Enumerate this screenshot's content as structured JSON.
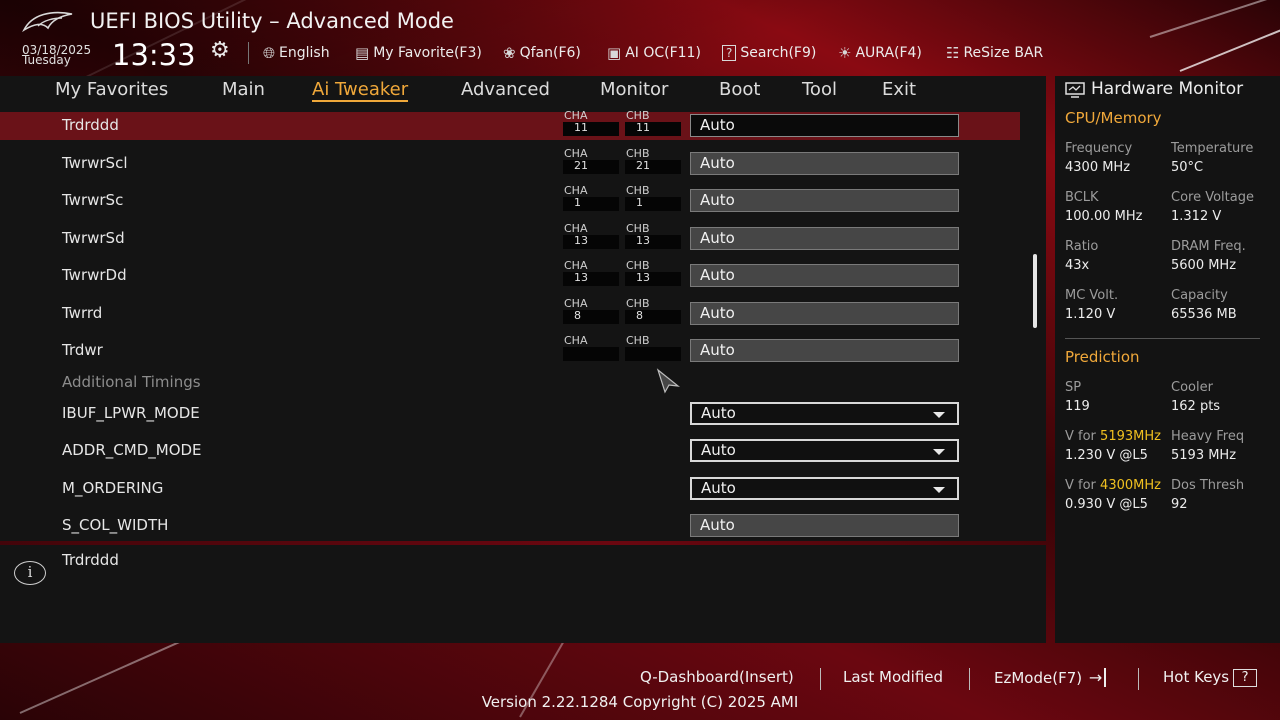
{
  "header": {
    "title": "UEFI BIOS Utility – Advanced Mode",
    "date": "03/18/2025",
    "weekday": "Tuesday",
    "time": "13:33",
    "tools": [
      {
        "label": "English",
        "icon": "globe-icon"
      },
      {
        "label": "My Favorite(F3)",
        "icon": "favorite-list-icon"
      },
      {
        "label": "Qfan(F6)",
        "icon": "fan-icon"
      },
      {
        "label": "AI OC(F11)",
        "icon": "ai-chip-icon"
      },
      {
        "label": "Search(F9)",
        "icon": "search-icon"
      },
      {
        "label": "AURA(F4)",
        "icon": "aura-light-icon"
      },
      {
        "label": "ReSize BAR",
        "icon": "resize-bar-icon"
      }
    ]
  },
  "nav": {
    "tabs": [
      "My Favorites",
      "Main",
      "Ai Tweaker",
      "Advanced",
      "Monitor",
      "Boot",
      "Tool",
      "Exit"
    ],
    "active": "Ai Tweaker"
  },
  "settings": {
    "channel_a_label": "CHA",
    "channel_b_label": "CHB",
    "rows": [
      {
        "label": "Trdrddd",
        "cha": "11",
        "chb": "11",
        "value": "Auto"
      },
      {
        "label": "TwrwrScl",
        "cha": "21",
        "chb": "21",
        "value": "Auto"
      },
      {
        "label": "TwrwrSc",
        "cha": "1",
        "chb": "1",
        "value": "Auto"
      },
      {
        "label": "TwrwrSd",
        "cha": "13",
        "chb": "13",
        "value": "Auto"
      },
      {
        "label": "TwrwrDd",
        "cha": "13",
        "chb": "13",
        "value": "Auto"
      },
      {
        "label": "Twrrd",
        "cha": "8",
        "chb": "8",
        "value": "Auto"
      },
      {
        "label": "Trdwr",
        "cha": "",
        "chb": "",
        "value": "Auto"
      }
    ],
    "section_additional": "Additional Timings",
    "additional_rows": [
      {
        "label": "IBUF_LPWR_MODE",
        "value": "Auto"
      },
      {
        "label": "ADDR_CMD_MODE",
        "value": "Auto"
      },
      {
        "label": "M_ORDERING",
        "value": "Auto"
      },
      {
        "label": "S_COL_WIDTH",
        "value": "Auto"
      }
    ]
  },
  "info": {
    "text": "Trdrddd"
  },
  "hardware_monitor": {
    "title": "Hardware Monitor",
    "cpu_memory": {
      "heading": "CPU/Memory",
      "frequency_label": "Frequency",
      "frequency": "4300 MHz",
      "temperature_label": "Temperature",
      "temperature": "50°C",
      "bclk_label": "BCLK",
      "bclk": "100.00 MHz",
      "core_voltage_label": "Core Voltage",
      "core_voltage": "1.312 V",
      "ratio_label": "Ratio",
      "ratio": "43x",
      "dram_freq_label": "DRAM Freq.",
      "dram_freq": "5600 MHz",
      "mc_volt_label": "MC Volt.",
      "mc_volt": "1.120 V",
      "capacity_label": "Capacity",
      "capacity": "65536 MB"
    },
    "prediction": {
      "heading": "Prediction",
      "sp_label": "SP",
      "sp": "119",
      "cooler_label": "Cooler",
      "cooler": "162 pts",
      "v_for_prefix": "V for ",
      "v_for_1_freq": "5193MHz",
      "v_for_1": "1.230 V @L5",
      "heavy_freq_label": "Heavy Freq",
      "heavy_freq": "5193 MHz",
      "v_for_2_freq": "4300MHz",
      "v_for_2": "0.930 V @L5",
      "dos_thresh_label": "Dos Thresh",
      "dos_thresh": "92"
    }
  },
  "footer": {
    "q_dashboard": "Q-Dashboard(Insert)",
    "last_modified": "Last Modified",
    "ezmode": "EzMode(F7)",
    "hot_keys": "Hot Keys",
    "hot_keys_key": "?",
    "version": "Version 2.22.1284 Copyright (C) 2025 AMI"
  },
  "colors": {
    "accent": "#f0a83a",
    "selection": "#6a1218",
    "highlight": "#f0c020"
  }
}
